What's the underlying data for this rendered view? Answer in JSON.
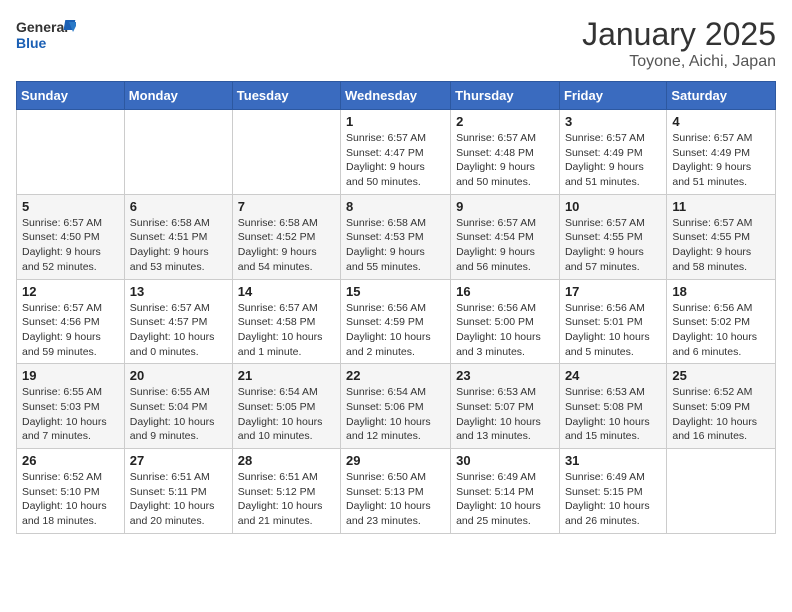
{
  "logo": {
    "text_general": "General",
    "text_blue": "Blue"
  },
  "title": "January 2025",
  "subtitle": "Toyone, Aichi, Japan",
  "weekdays": [
    "Sunday",
    "Monday",
    "Tuesday",
    "Wednesday",
    "Thursday",
    "Friday",
    "Saturday"
  ],
  "weeks": [
    [
      {
        "day": "",
        "info": ""
      },
      {
        "day": "",
        "info": ""
      },
      {
        "day": "",
        "info": ""
      },
      {
        "day": "1",
        "info": "Sunrise: 6:57 AM\nSunset: 4:47 PM\nDaylight: 9 hours\nand 50 minutes."
      },
      {
        "day": "2",
        "info": "Sunrise: 6:57 AM\nSunset: 4:48 PM\nDaylight: 9 hours\nand 50 minutes."
      },
      {
        "day": "3",
        "info": "Sunrise: 6:57 AM\nSunset: 4:49 PM\nDaylight: 9 hours\nand 51 minutes."
      },
      {
        "day": "4",
        "info": "Sunrise: 6:57 AM\nSunset: 4:49 PM\nDaylight: 9 hours\nand 51 minutes."
      }
    ],
    [
      {
        "day": "5",
        "info": "Sunrise: 6:57 AM\nSunset: 4:50 PM\nDaylight: 9 hours\nand 52 minutes."
      },
      {
        "day": "6",
        "info": "Sunrise: 6:58 AM\nSunset: 4:51 PM\nDaylight: 9 hours\nand 53 minutes."
      },
      {
        "day": "7",
        "info": "Sunrise: 6:58 AM\nSunset: 4:52 PM\nDaylight: 9 hours\nand 54 minutes."
      },
      {
        "day": "8",
        "info": "Sunrise: 6:58 AM\nSunset: 4:53 PM\nDaylight: 9 hours\nand 55 minutes."
      },
      {
        "day": "9",
        "info": "Sunrise: 6:57 AM\nSunset: 4:54 PM\nDaylight: 9 hours\nand 56 minutes."
      },
      {
        "day": "10",
        "info": "Sunrise: 6:57 AM\nSunset: 4:55 PM\nDaylight: 9 hours\nand 57 minutes."
      },
      {
        "day": "11",
        "info": "Sunrise: 6:57 AM\nSunset: 4:55 PM\nDaylight: 9 hours\nand 58 minutes."
      }
    ],
    [
      {
        "day": "12",
        "info": "Sunrise: 6:57 AM\nSunset: 4:56 PM\nDaylight: 9 hours\nand 59 minutes."
      },
      {
        "day": "13",
        "info": "Sunrise: 6:57 AM\nSunset: 4:57 PM\nDaylight: 10 hours\nand 0 minutes."
      },
      {
        "day": "14",
        "info": "Sunrise: 6:57 AM\nSunset: 4:58 PM\nDaylight: 10 hours\nand 1 minute."
      },
      {
        "day": "15",
        "info": "Sunrise: 6:56 AM\nSunset: 4:59 PM\nDaylight: 10 hours\nand 2 minutes."
      },
      {
        "day": "16",
        "info": "Sunrise: 6:56 AM\nSunset: 5:00 PM\nDaylight: 10 hours\nand 3 minutes."
      },
      {
        "day": "17",
        "info": "Sunrise: 6:56 AM\nSunset: 5:01 PM\nDaylight: 10 hours\nand 5 minutes."
      },
      {
        "day": "18",
        "info": "Sunrise: 6:56 AM\nSunset: 5:02 PM\nDaylight: 10 hours\nand 6 minutes."
      }
    ],
    [
      {
        "day": "19",
        "info": "Sunrise: 6:55 AM\nSunset: 5:03 PM\nDaylight: 10 hours\nand 7 minutes."
      },
      {
        "day": "20",
        "info": "Sunrise: 6:55 AM\nSunset: 5:04 PM\nDaylight: 10 hours\nand 9 minutes."
      },
      {
        "day": "21",
        "info": "Sunrise: 6:54 AM\nSunset: 5:05 PM\nDaylight: 10 hours\nand 10 minutes."
      },
      {
        "day": "22",
        "info": "Sunrise: 6:54 AM\nSunset: 5:06 PM\nDaylight: 10 hours\nand 12 minutes."
      },
      {
        "day": "23",
        "info": "Sunrise: 6:53 AM\nSunset: 5:07 PM\nDaylight: 10 hours\nand 13 minutes."
      },
      {
        "day": "24",
        "info": "Sunrise: 6:53 AM\nSunset: 5:08 PM\nDaylight: 10 hours\nand 15 minutes."
      },
      {
        "day": "25",
        "info": "Sunrise: 6:52 AM\nSunset: 5:09 PM\nDaylight: 10 hours\nand 16 minutes."
      }
    ],
    [
      {
        "day": "26",
        "info": "Sunrise: 6:52 AM\nSunset: 5:10 PM\nDaylight: 10 hours\nand 18 minutes."
      },
      {
        "day": "27",
        "info": "Sunrise: 6:51 AM\nSunset: 5:11 PM\nDaylight: 10 hours\nand 20 minutes."
      },
      {
        "day": "28",
        "info": "Sunrise: 6:51 AM\nSunset: 5:12 PM\nDaylight: 10 hours\nand 21 minutes."
      },
      {
        "day": "29",
        "info": "Sunrise: 6:50 AM\nSunset: 5:13 PM\nDaylight: 10 hours\nand 23 minutes."
      },
      {
        "day": "30",
        "info": "Sunrise: 6:49 AM\nSunset: 5:14 PM\nDaylight: 10 hours\nand 25 minutes."
      },
      {
        "day": "31",
        "info": "Sunrise: 6:49 AM\nSunset: 5:15 PM\nDaylight: 10 hours\nand 26 minutes."
      },
      {
        "day": "",
        "info": ""
      }
    ]
  ]
}
